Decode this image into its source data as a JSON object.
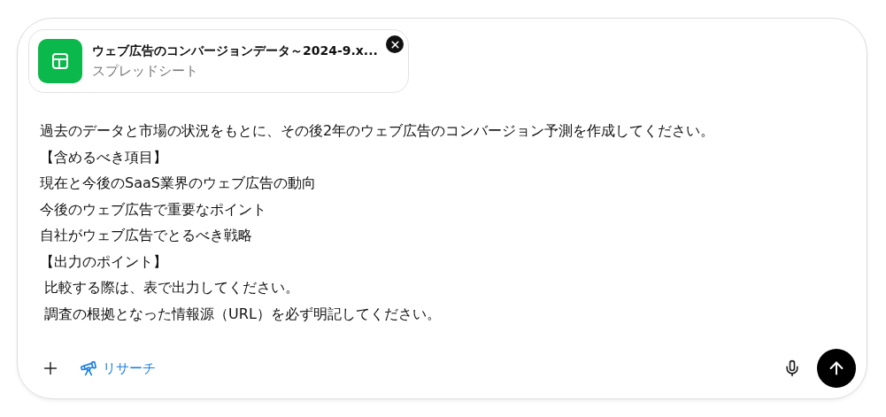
{
  "attachment": {
    "name": "ウェブ広告のコンバージョンデータ～2024-9.x...",
    "type": "スプレッドシート"
  },
  "message_lines": [
    "過去のデータと市場の状況をもとに、その後2年のウェブ広告のコンバージョン予測を作成してください。",
    "【含めるべき項目】",
    "現在と今後のSaaS業界のウェブ広告の動向",
    "今後のウェブ広告で重要なポイント",
    "自社がウェブ広告でとるべき戦略",
    "【出力のポイント】",
    " 比較する際は、表で出力してください。",
    " 調査の根拠となった情報源（URL）を必ず明記してください。"
  ],
  "toolbar": {
    "research_label": "リサーチ"
  }
}
